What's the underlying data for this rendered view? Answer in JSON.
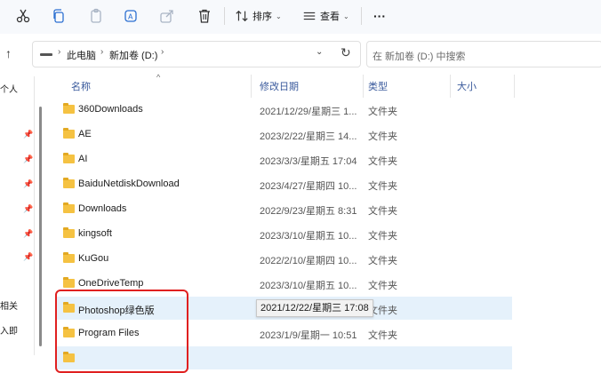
{
  "toolbar": {
    "icons": [
      "cut-icon",
      "copy-icon",
      "paste-icon",
      "rename-icon",
      "share-icon",
      "delete-icon"
    ],
    "sort_label": "排序",
    "view_label": "查看",
    "more_label": "···"
  },
  "address": {
    "crumbs": [
      "此电脑",
      "新加卷 (D:)"
    ],
    "search_placeholder": "在 新加卷 (D:) 中搜索"
  },
  "nav": {
    "items": [
      {
        "label": "个人"
      },
      {
        "label": "相关"
      },
      {
        "label": "入即"
      }
    ]
  },
  "table": {
    "columns": [
      "名称",
      "修改日期",
      "类型",
      "大小"
    ],
    "rows": [
      {
        "name": "360Downloads",
        "date": "2021/12/29/星期三 1...",
        "type": "文件夹"
      },
      {
        "name": "AE",
        "date": "2023/2/22/星期三 14...",
        "type": "文件夹"
      },
      {
        "name": "AI",
        "date": "2023/3/3/星期五 17:04",
        "type": "文件夹"
      },
      {
        "name": "BaiduNetdiskDownload",
        "date": "2023/4/27/星期四 10...",
        "type": "文件夹"
      },
      {
        "name": "Downloads",
        "date": "2022/9/23/星期五 8:31",
        "type": "文件夹"
      },
      {
        "name": "kingsoft",
        "date": "2023/3/10/星期五 10...",
        "type": "文件夹"
      },
      {
        "name": "KuGou",
        "date": "2022/2/10/星期四 10...",
        "type": "文件夹"
      },
      {
        "name": "OneDriveTemp",
        "date": "2023/3/10/星期五 10...",
        "type": "文件夹"
      },
      {
        "name": "Photoshop绿色版",
        "date": "",
        "type": "文件夹"
      },
      {
        "name": "Program Files",
        "date": "2023/1/9/星期一 10:51",
        "type": "文件夹"
      }
    ]
  },
  "tooltip": "2021/12/22/星期三 17:08",
  "colors": {
    "accent": "#3a5a9c",
    "selection": "#e5f1fb",
    "folder": "#f5c242",
    "highlight": "#e02020"
  }
}
